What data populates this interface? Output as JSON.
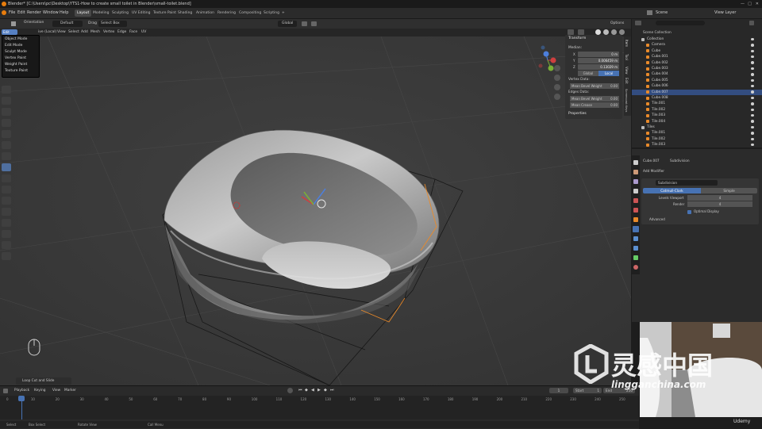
{
  "window_title": "Blender* [C:\\Users\\pc\\Desktop\\YTS1-How to create small toilet in Blender\\small-toilet.blend]",
  "menu": [
    "File",
    "Edit",
    "Render",
    "Window",
    "Help"
  ],
  "workspaces": [
    "Layout",
    "Modeling",
    "Sculpting",
    "UV Editing",
    "Texture Paint",
    "Shading",
    "Animation",
    "Rendering",
    "Compositing",
    "Scripting"
  ],
  "active_workspace": "Layout",
  "scene_label": "Scene",
  "view_layer_label": "View Layer",
  "tool_header": {
    "mode": "Edit Mode",
    "orientation_label": "Orientation",
    "orientation_value": "Default",
    "drag_label": "Drag",
    "drag_value": "Select Box",
    "pivot": "Global",
    "options": "Options"
  },
  "viewport_header": {
    "perspective_text": "ive (Local)",
    "items": [
      "View",
      "Select",
      "Add",
      "Mesh",
      "Vertex",
      "Edge",
      "Face",
      "UV"
    ]
  },
  "mode_menu": [
    "Object Mode",
    "Edit Mode",
    "Sculpt Mode",
    "Vertex Paint",
    "Weight Paint",
    "Texture Paint"
  ],
  "n_panel": {
    "transform_title": "Transform",
    "median_label": "Median:",
    "x_label": "X",
    "x_value": "0 m",
    "y_label": "Y",
    "y_value": "0.006459 m",
    "z_label": "Z",
    "z_value": "0.13029 m",
    "global": "Global",
    "local": "Local",
    "vertex_data": "Vertex Data:",
    "mean_bevel_weight_1": "Mean Bevel Weight",
    "mbw1_value": "0.00",
    "edges_data": "Edges Data:",
    "mean_bevel_weight_2": "Mean Bevel Weight",
    "mbw2_value": "0.00",
    "mean_crease": "Mean Crease",
    "mc_value": "0.00",
    "properties": "Properties"
  },
  "side_tabs": [
    "Item",
    "Tool",
    "View",
    "Edit",
    "Screencast Keys"
  ],
  "outliner": {
    "root": "Scene Collection",
    "rows": [
      {
        "name": "Collection",
        "indent": 1
      },
      {
        "name": "Camera",
        "indent": 2
      },
      {
        "name": "Cube",
        "indent": 2
      },
      {
        "name": "Cube.001",
        "indent": 2
      },
      {
        "name": "Cube.002",
        "indent": 2
      },
      {
        "name": "Cube.003",
        "indent": 2
      },
      {
        "name": "Cube.004",
        "indent": 2
      },
      {
        "name": "Cube.005",
        "indent": 2
      },
      {
        "name": "Cube.006",
        "indent": 2
      },
      {
        "name": "Cube.007",
        "indent": 2,
        "selected": true
      },
      {
        "name": "Cube.008",
        "indent": 2
      },
      {
        "name": "Tile.001",
        "indent": 2
      },
      {
        "name": "Tile.002",
        "indent": 2
      },
      {
        "name": "Tile.003",
        "indent": 2
      },
      {
        "name": "Tile.004",
        "indent": 2
      },
      {
        "name": "Tiles",
        "indent": 1
      },
      {
        "name": "Tile.001",
        "indent": 2
      },
      {
        "name": "Tile.002",
        "indent": 2
      },
      {
        "name": "Tile.003",
        "indent": 2
      }
    ]
  },
  "properties": {
    "object_name": "Cube.007",
    "modifier_breadcrumb": "Subdivision",
    "add_modifier": "Add Modifier",
    "modifier_name": "Subdivision",
    "catmull_clark": "Catmull-Clark",
    "simple": "Simple",
    "levels_viewport_label": "Levels Viewport",
    "levels_viewport_value": "4",
    "render_label": "Render",
    "render_value": "4",
    "optimal_display": "Optimal Display",
    "advanced": "Advanced"
  },
  "timeline": {
    "menus": [
      "Playback",
      "Keying",
      "View",
      "Marker"
    ],
    "current_frame": "1",
    "start_label": "Start",
    "start_value": "1",
    "end_label": "End",
    "end_value": "250",
    "frames": [
      "0",
      "10",
      "20",
      "30",
      "40",
      "50",
      "60",
      "70",
      "80",
      "90",
      "100",
      "110",
      "120",
      "130",
      "140",
      "150",
      "160",
      "170",
      "180",
      "190",
      "200",
      "210",
      "220",
      "230",
      "240",
      "250"
    ]
  },
  "operator_panel": "Loop Cut and Slide",
  "status_bar": {
    "select": "Select",
    "box_select": "Box Select",
    "rotate_view": "Rotate View",
    "call_menu": "Call Menu"
  },
  "watermark": {
    "brand": "灵感中国",
    "url": "lingganchina.com",
    "udemy": "Udemy"
  },
  "colors": {
    "accent": "#4772b3",
    "selected_row": "#334d80",
    "object_orange": "#e98a2a",
    "mesh_gray": "#8a8a8a"
  }
}
